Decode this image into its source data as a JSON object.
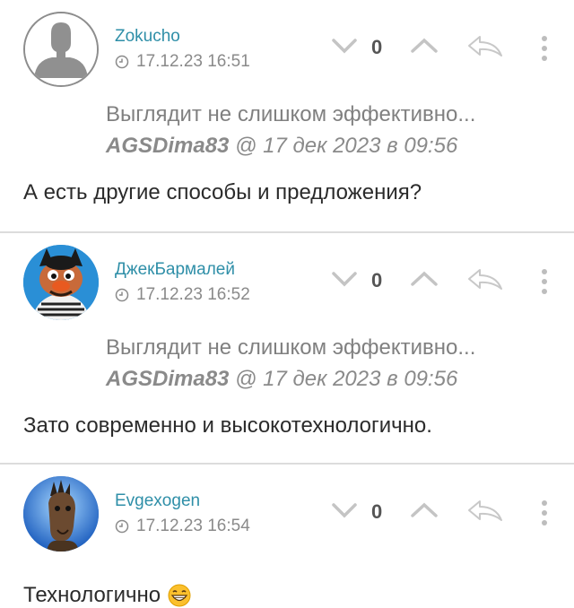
{
  "comments": [
    {
      "author": "Zokucho",
      "timestamp": "17.12.23 16:51",
      "score": "0",
      "quote": {
        "text": "Выглядит не слишком эффективно...",
        "author": "AGSDima83",
        "rest": " @ 17 дек 2023 в 09:56"
      },
      "body": "А есть другие способы и предложения?"
    },
    {
      "author": "ДжекБармалей",
      "timestamp": "17.12.23 16:52",
      "score": "0",
      "quote": {
        "text": "Выглядит не слишком эффективно...",
        "author": "AGSDima83",
        "rest": " @ 17 дек 2023 в 09:56"
      },
      "body": "Зато современно и высокотехнологично."
    },
    {
      "author": "Evgexogen",
      "timestamp": "17.12.23 16:54",
      "score": "0",
      "body": "Технологично"
    }
  ],
  "icons": {
    "clock": "clock-icon",
    "vote_down": "chevron-down-icon",
    "vote_up": "chevron-up-icon",
    "reply": "reply-arrow-icon",
    "more": "more-vertical-icon",
    "emoji": "grinning-face-emoji"
  },
  "colors": {
    "author_link": "#2f8fa8",
    "muted": "#8a8a8a",
    "divider": "#dcdcdc"
  }
}
